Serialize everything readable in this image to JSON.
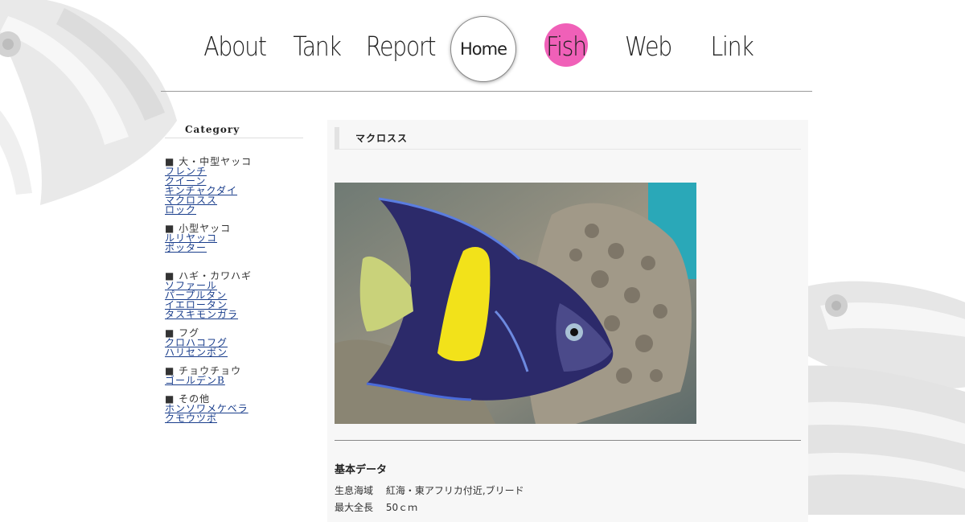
{
  "nav": {
    "items": [
      {
        "label": "About",
        "color": "#5566dd"
      },
      {
        "label": "Tank",
        "color": "#33ccdd"
      },
      {
        "label": "Report",
        "color": "#33dd22"
      },
      {
        "label": "Fish",
        "color": "#f060b8"
      },
      {
        "label": "Web",
        "color": "#ee8833"
      },
      {
        "label": "Link",
        "color": "#eedd33"
      }
    ],
    "home_label": "Home"
  },
  "sidebar": {
    "title": "Category",
    "groups": [
      {
        "head": "■ 大・中型ヤッコ",
        "links": [
          "フレンチ",
          "クイーン",
          "キンチャクダイ",
          "マクロスス",
          "ロック"
        ]
      },
      {
        "head": "■ 小型ヤッコ",
        "links": [
          "ルリヤッコ",
          "ポッター"
        ]
      },
      {
        "head": "■ ハギ・カワハギ",
        "links": [
          "ソファール",
          "パープルタン",
          "イエロータン",
          "タスキモンガラ"
        ]
      },
      {
        "head": "■ フグ",
        "links": [
          "クロハコフグ",
          "ハリセンボン"
        ]
      },
      {
        "head": "■ チョウチョウ",
        "links": [
          "ゴールデンB"
        ]
      },
      {
        "head": "■ その他",
        "links": [
          "ホンソワメケベラ",
          "クモウツボ"
        ]
      }
    ]
  },
  "main": {
    "title": "マクロスス",
    "section_title": "基本データ",
    "rows": [
      {
        "key": "生息海域",
        "value": "紅海・東アフリカ付近,ブリード"
      },
      {
        "key": "最大全長",
        "value": "50ｃｍ"
      }
    ]
  },
  "colors": {
    "fish_accent": "#f060b8",
    "fish_yellow": "#f2e21a",
    "fish_body": "#2c2a6a"
  }
}
